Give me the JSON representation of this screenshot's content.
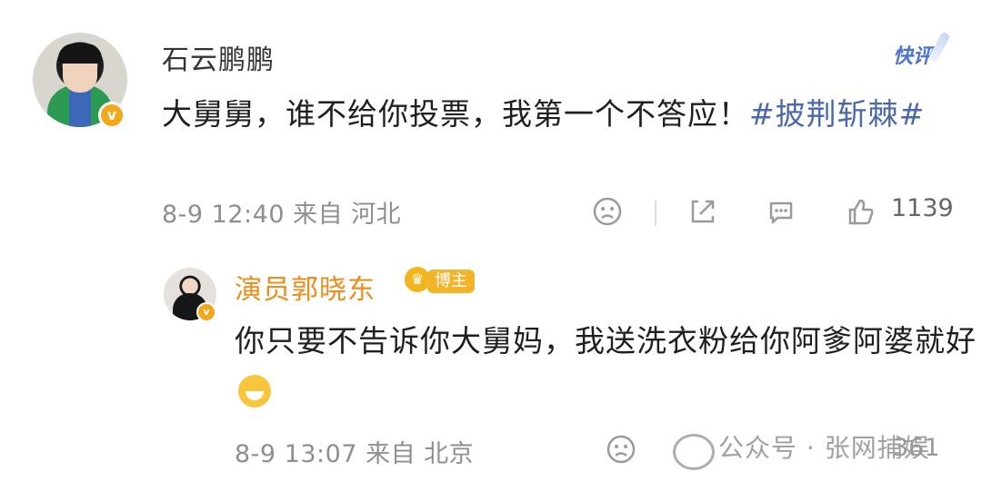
{
  "post": {
    "username": "石云鹏鹏",
    "badge": "快评",
    "text": "大舅舅，谁不给你投票，我第一个不答应！",
    "topic": "#披荆斩棘#",
    "time": "8-9 12:40",
    "source": "来自 河北",
    "like_count": "1139"
  },
  "reply": {
    "username": "演员郭晓东",
    "badge": "博主",
    "text": "你只要不告诉你大舅妈，我送洗衣粉给你阿爹阿婆就好",
    "time": "8-9 13:07",
    "source": "来自 北京",
    "like_count": "361"
  },
  "watermark": "公众号 · 张网捕娱"
}
